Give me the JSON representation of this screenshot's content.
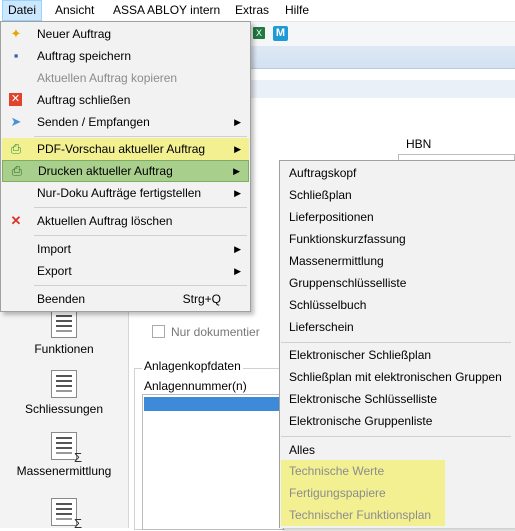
{
  "menubar": {
    "items": [
      {
        "label": "Datei",
        "active": true
      },
      {
        "label": "Ansicht"
      },
      {
        "label": "ASSA ABLOY intern"
      },
      {
        "label": "Extras"
      },
      {
        "label": "Hilfe"
      }
    ]
  },
  "background": {
    "hbn_label": "HBN",
    "nur_doku_label": "Nur dokumentier",
    "group_title": "Anlagenkopfdaten",
    "anlagen_label": "Anlagennummer(n)",
    "left_panel": [
      {
        "label": "Funktionen",
        "icon": "document-list-icon"
      },
      {
        "label": "Schliessungen",
        "icon": "key-document-icon"
      },
      {
        "label": "Massenermittlung",
        "icon": "sum-document-icon"
      }
    ]
  },
  "datei_menu": {
    "items": [
      {
        "label": "Neuer Auftrag",
        "icon": "new-document-icon"
      },
      {
        "label": "Auftrag speichern",
        "icon": "floppy-disk-icon"
      },
      {
        "label": "Aktuellen Auftrag kopieren",
        "disabled": true
      },
      {
        "label": "Auftrag schließen",
        "icon": "close-red-icon"
      },
      {
        "label": "Senden / Empfangen",
        "icon": "send-plane-icon",
        "submenu": true
      },
      {
        "label": "PDF-Vorschau aktueller Auftrag",
        "icon": "pdf-preview-icon",
        "submenu": true,
        "highlight": "yellow"
      },
      {
        "label": "Drucken aktueller Auftrag",
        "icon": "printer-icon",
        "submenu": true,
        "highlight": "green"
      },
      {
        "label": "Nur-Doku Aufträge fertigstellen",
        "submenu": true
      },
      {
        "label": "Aktuellen Auftrag löschen",
        "icon": "delete-x-icon"
      },
      {
        "label": "Import",
        "submenu": true
      },
      {
        "label": "Export",
        "submenu": true
      },
      {
        "label": "Beenden",
        "shortcut": "Strg+Q"
      }
    ]
  },
  "drucken_submenu": {
    "items": [
      {
        "label": "Auftragskopf"
      },
      {
        "label": "Schließplan"
      },
      {
        "label": "Lieferpositionen"
      },
      {
        "label": "Funktionskurzfassung"
      },
      {
        "label": "Massenermittlung"
      },
      {
        "label": "Gruppenschlüsselliste"
      },
      {
        "label": "Schlüsselbuch"
      },
      {
        "label": "Lieferschein"
      },
      {
        "label": "Elektronischer Schließplan"
      },
      {
        "label": "Schließplan mit elektronischen Gruppen"
      },
      {
        "label": "Elektronische Schlüsselliste"
      },
      {
        "label": "Elektronische Gruppenliste"
      },
      {
        "label": "Alles"
      },
      {
        "label": "Technische Werte",
        "disabled": true,
        "highlight": "yellow"
      },
      {
        "label": "Fertigungspapiere",
        "disabled": true,
        "highlight": "yellow"
      },
      {
        "label": "Technischer Funktionsplan",
        "disabled": true,
        "highlight": "yellow"
      }
    ]
  },
  "colors": {
    "menu_bg": "#f2f2f2",
    "highlight_yellow": "#f3f092",
    "highlight_green": "#a9cf8c",
    "menubar_active": "#cce8ff",
    "disabled_text": "#8c8c8c"
  }
}
